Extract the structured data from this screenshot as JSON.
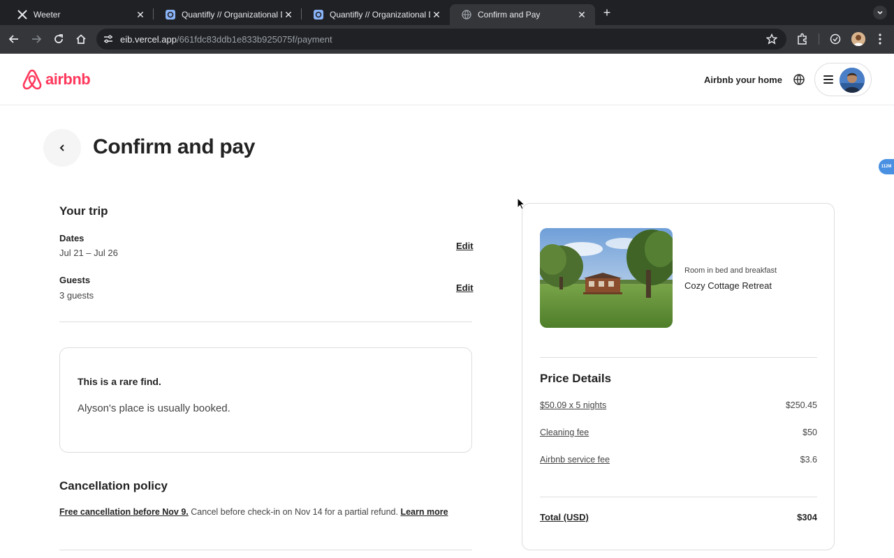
{
  "browser": {
    "tabs": [
      {
        "title": "Weeter",
        "favicon": "x-logo-icon",
        "active": false
      },
      {
        "title": "Quantifly // Organizational Dia",
        "favicon": "quantifly-icon",
        "active": false
      },
      {
        "title": "Quantifly // Organizational Dia",
        "favicon": "quantifly-icon",
        "active": false
      },
      {
        "title": "Confirm and Pay",
        "favicon": "globe-icon",
        "active": true
      }
    ],
    "url_host": "eib.vercel.app",
    "url_path": "/661fdc83ddb1e833b925075f/payment"
  },
  "header": {
    "brand": "airbnb",
    "brand_color": "#ff385c",
    "host_link": "Airbnb your home"
  },
  "page": {
    "title": "Confirm and pay",
    "badge": "112M"
  },
  "trip": {
    "heading": "Your trip",
    "dates_label": "Dates",
    "dates_value": "Jul 21 – Jul 26",
    "guests_label": "Guests",
    "guests_value": "3 guests",
    "edit_label": "Edit"
  },
  "rare": {
    "title": "This is a rare find.",
    "subtitle": "Alyson's place is usually booked."
  },
  "cancellation": {
    "heading": "Cancellation policy",
    "free_text": "Free cancellation before Nov 9.",
    "detail": " Cancel before check-in on Nov 14 for a partial refund. ",
    "learn_more": "Learn more"
  },
  "listing": {
    "type": "Room in bed and breakfast",
    "name": "Cozy Cottage Retreat"
  },
  "price": {
    "heading": "Price Details",
    "rows": [
      {
        "label": "$50.09 x 5 nights",
        "value": "$250.45"
      },
      {
        "label": "Cleaning fee",
        "value": "$50"
      },
      {
        "label": "Airbnb service fee",
        "value": "$3.6"
      }
    ],
    "total_label": "Total (USD)",
    "total_value": "$304"
  }
}
